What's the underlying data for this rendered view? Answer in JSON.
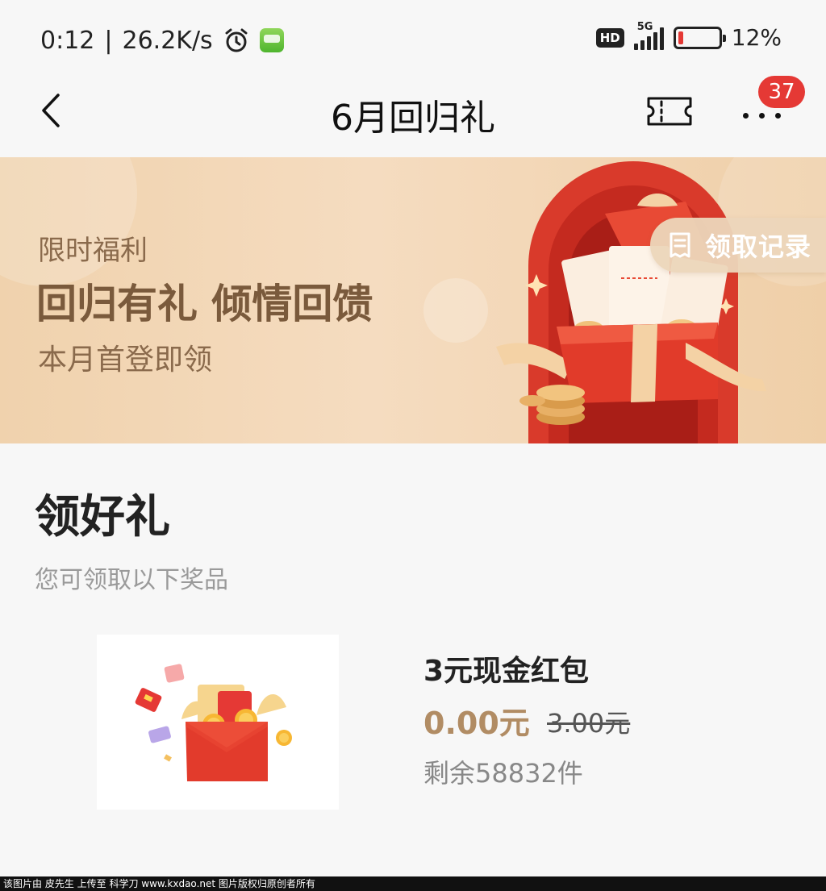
{
  "status_bar": {
    "time": "0:12",
    "separator": "|",
    "speed": "26.2K/s",
    "hd": "HD",
    "network": "5G",
    "battery_text": "12%",
    "battery_level": 0.12,
    "alarm_icon": "alarm-clock-icon",
    "app_icon": "app-notification-icon"
  },
  "nav": {
    "title": "6月回归礼",
    "back_icon": "chevron-left-icon",
    "ticket_icon": "ticket-icon",
    "more_icon": "more-dots-icon",
    "badge_count": "37",
    "badge_color": "#e53935"
  },
  "banner": {
    "tag": "限时福利",
    "headline": "回归有礼 倾情回馈",
    "subtitle": "本月首登即领",
    "record_label": "领取记录",
    "record_icon": "receipt-icon",
    "illustration": "gift-box-illustration",
    "colors": {
      "background": "#f0d2ad",
      "text": "#7a5a3c",
      "accent": "#e53935"
    }
  },
  "section": {
    "title": "领好礼",
    "subtitle": "您可领取以下奖品"
  },
  "prizes": [
    {
      "name": "3元现金红包",
      "price": "0.00元",
      "original_price": "3.00元",
      "stock": "剩余58832件",
      "image": "red-envelope-illustration",
      "price_color": "#b18c64"
    }
  ],
  "watermark": "该图片由 皮先生 上传至 科学刀 www.kxdao.net 图片版权归原创者所有"
}
